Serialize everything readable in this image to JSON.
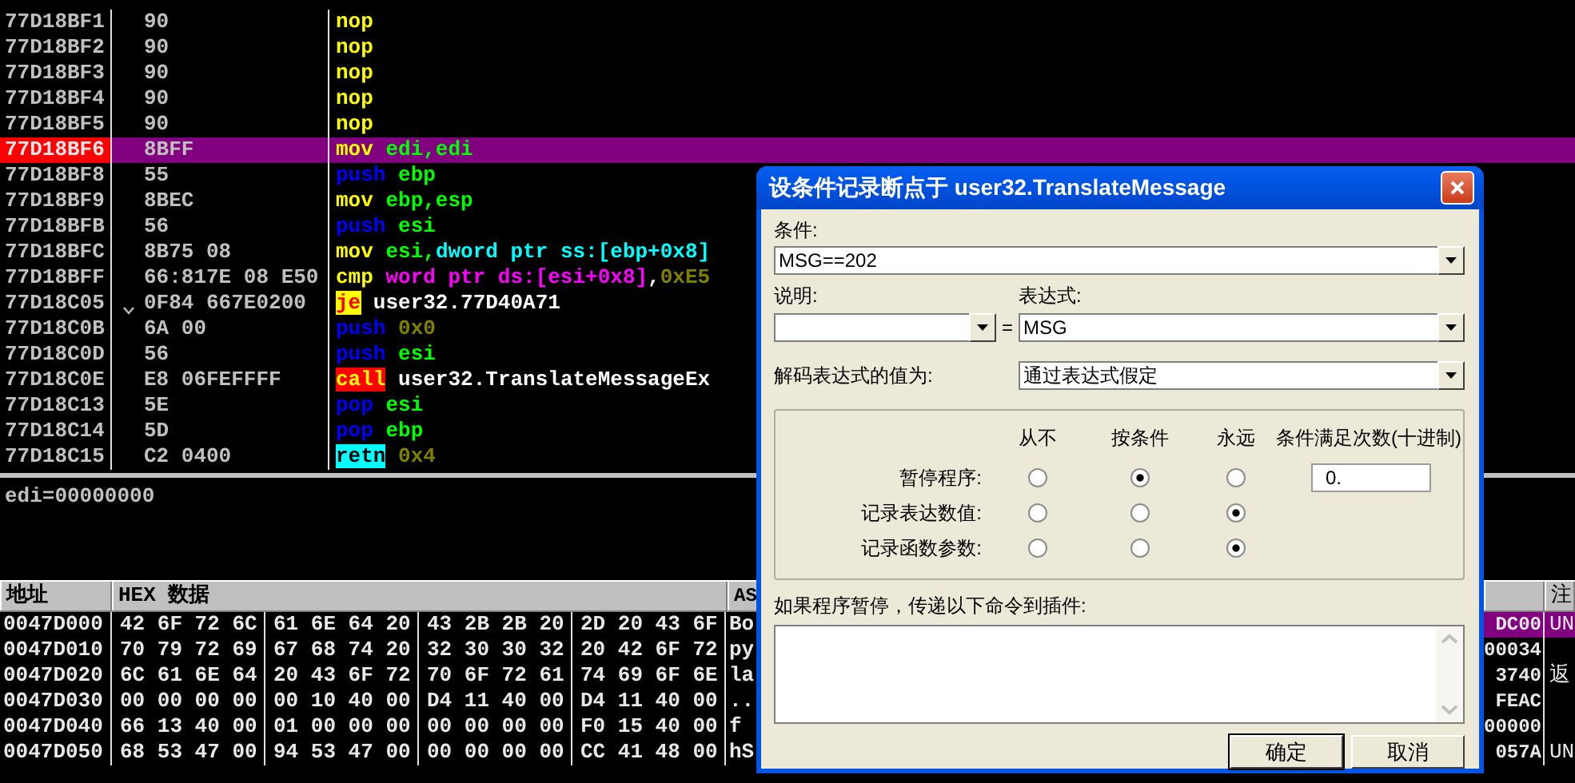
{
  "disassembly": {
    "rows": [
      {
        "address": "77D18BF1",
        "hex": "90",
        "jump_mark": false,
        "selected": false,
        "tokens": [
          {
            "text": "nop",
            "kind": "mnemonic"
          }
        ]
      },
      {
        "address": "77D18BF2",
        "hex": "90",
        "jump_mark": false,
        "selected": false,
        "tokens": [
          {
            "text": "nop",
            "kind": "mnemonic"
          }
        ]
      },
      {
        "address": "77D18BF3",
        "hex": "90",
        "jump_mark": false,
        "selected": false,
        "tokens": [
          {
            "text": "nop",
            "kind": "mnemonic"
          }
        ]
      },
      {
        "address": "77D18BF4",
        "hex": "90",
        "jump_mark": false,
        "selected": false,
        "tokens": [
          {
            "text": "nop",
            "kind": "mnemonic"
          }
        ]
      },
      {
        "address": "77D18BF5",
        "hex": "90",
        "jump_mark": false,
        "selected": false,
        "tokens": [
          {
            "text": "nop",
            "kind": "mnemonic"
          }
        ]
      },
      {
        "address": "77D18BF6",
        "hex": "8BFF",
        "jump_mark": false,
        "selected": true,
        "tokens": [
          {
            "text": "mov",
            "kind": "mnemonic"
          },
          {
            "text": "edi,edi",
            "kind": "register"
          }
        ]
      },
      {
        "address": "77D18BF8",
        "hex": "55",
        "jump_mark": false,
        "selected": false,
        "tokens": [
          {
            "text": "push",
            "kind": "stack"
          },
          {
            "text": "ebp",
            "kind": "register"
          }
        ]
      },
      {
        "address": "77D18BF9",
        "hex": "8BEC",
        "jump_mark": false,
        "selected": false,
        "tokens": [
          {
            "text": "mov",
            "kind": "mnemonic"
          },
          {
            "text": "ebp,esp",
            "kind": "register"
          }
        ]
      },
      {
        "address": "77D18BFB",
        "hex": "56",
        "jump_mark": false,
        "selected": false,
        "tokens": [
          {
            "text": "push",
            "kind": "stack"
          },
          {
            "text": "esi",
            "kind": "register"
          }
        ]
      },
      {
        "address": "77D18BFC",
        "hex": "8B75 08",
        "jump_mark": false,
        "selected": false,
        "tokens": [
          {
            "text": "mov",
            "kind": "mnemonic"
          },
          {
            "text": "esi,",
            "kind": "register"
          },
          {
            "text": "dword ptr ss:[ebp+0x8]",
            "kind": "memory_ss"
          }
        ]
      },
      {
        "address": "77D18BFF",
        "hex": "66:817E 08 E50",
        "jump_mark": false,
        "selected": false,
        "tokens": [
          {
            "text": "cmp",
            "kind": "mnemonic"
          },
          {
            "text": "word ptr ds:[esi+0x8]",
            "kind": "memory_ds"
          },
          {
            "text": ",",
            "kind": "separator"
          },
          {
            "text": "0xE5",
            "kind": "constant"
          }
        ]
      },
      {
        "address": "77D18C05",
        "hex": "0F84 667E0200",
        "jump_mark": true,
        "selected": false,
        "tokens": [
          {
            "text": "je",
            "kind": "jump"
          },
          {
            "text": "user32.77D40A71",
            "kind": "symbol"
          }
        ]
      },
      {
        "address": "77D18C0B",
        "hex": "6A 00",
        "jump_mark": false,
        "selected": false,
        "tokens": [
          {
            "text": "push",
            "kind": "stack"
          },
          {
            "text": "0x0",
            "kind": "constant"
          }
        ]
      },
      {
        "address": "77D18C0D",
        "hex": "56",
        "jump_mark": false,
        "selected": false,
        "tokens": [
          {
            "text": "push",
            "kind": "stack"
          },
          {
            "text": "esi",
            "kind": "register"
          }
        ]
      },
      {
        "address": "77D18C0E",
        "hex": "E8 06FEFFFF",
        "jump_mark": false,
        "selected": false,
        "tokens": [
          {
            "text": "call",
            "kind": "call"
          },
          {
            "text": "user32.TranslateMessageEx",
            "kind": "symbol"
          }
        ]
      },
      {
        "address": "77D18C13",
        "hex": "5E",
        "jump_mark": false,
        "selected": false,
        "tokens": [
          {
            "text": "pop",
            "kind": "stack"
          },
          {
            "text": "esi",
            "kind": "register"
          }
        ]
      },
      {
        "address": "77D18C14",
        "hex": "5D",
        "jump_mark": false,
        "selected": false,
        "tokens": [
          {
            "text": "pop",
            "kind": "stack"
          },
          {
            "text": "ebp",
            "kind": "register"
          }
        ]
      },
      {
        "address": "77D18C15",
        "hex": "C2 0400",
        "jump_mark": false,
        "selected": false,
        "tokens": [
          {
            "text": "retn",
            "kind": "ret"
          },
          {
            "text": "0x4",
            "kind": "constant"
          }
        ]
      }
    ]
  },
  "info": {
    "text": "edi=00000000"
  },
  "dump": {
    "columns": [
      "地址",
      "HEX 数据",
      "AS"
    ],
    "rows": [
      {
        "address": "0047D000",
        "bytes": [
          "42 6F 72 6C",
          "61 6E 64 20",
          "43 2B 2B 20",
          "2D 20 43 6F"
        ],
        "ascii": "Bo"
      },
      {
        "address": "0047D010",
        "bytes": [
          "70 79 72 69",
          "67 68 74 20",
          "32 30 30 32",
          "20 42 6F 72"
        ],
        "ascii": "py"
      },
      {
        "address": "0047D020",
        "bytes": [
          "6C 61 6E 64",
          "20 43 6F 72",
          "70 6F 72 61",
          "74 69 6F 6E"
        ],
        "ascii": "la"
      },
      {
        "address": "0047D030",
        "bytes": [
          "00 00 00 00",
          "00 10 40 00",
          "D4 11 40 00",
          "D4 11 40 00"
        ],
        "ascii": ".."
      },
      {
        "address": "0047D040",
        "bytes": [
          "66 13 40 00",
          "01 00 00 00",
          "00 00 00 00",
          "F0 15 40 00"
        ],
        "ascii": "f"
      },
      {
        "address": "0047D050",
        "bytes": [
          "68 53 47 00",
          "94 53 47 00",
          "00 00 00 00",
          "CC 41 48 00"
        ],
        "ascii": "hS"
      }
    ]
  },
  "stack": {
    "comment_header": "注",
    "rows": [
      {
        "value": "DC00",
        "comment": "UN",
        "selected": true
      },
      {
        "value": "00034",
        "comment": "",
        "selected": false
      },
      {
        "value": "3740",
        "comment": "返",
        "selected": false
      },
      {
        "value": "FEAC",
        "comment": "",
        "selected": false
      },
      {
        "value": "00000",
        "comment": "",
        "selected": false
      },
      {
        "value": "057A",
        "comment": "UN",
        "selected": false
      }
    ]
  },
  "dialog": {
    "title": "设条件记录断点于 user32.TranslateMessage",
    "condition": {
      "label": "条件:",
      "value": "MSG==202"
    },
    "explanation": {
      "label": "说明:"
    },
    "equals": "=",
    "expression": {
      "label": "表达式:",
      "value": "MSG"
    },
    "decode": {
      "label": "解码表达式的值为:",
      "value": "通过表达式假定"
    },
    "options": {
      "columns": [
        "从不",
        "按条件",
        "永远",
        "条件满足次数(十进制)"
      ],
      "rows": [
        {
          "label": "暂停程序:",
          "choices": [
            {
              "selected": false
            },
            {
              "selected": true
            },
            {
              "selected": false
            }
          ],
          "count": "0."
        },
        {
          "label": "记录表达数值:",
          "choices": [
            {
              "selected": false
            },
            {
              "selected": false
            },
            {
              "selected": true
            }
          ]
        },
        {
          "label": "记录函数参数:",
          "choices": [
            {
              "selected": false
            },
            {
              "selected": false
            },
            {
              "selected": true
            }
          ]
        }
      ]
    },
    "plugin_label": "如果程序暂停，传递以下命令到插件:",
    "buttons": [
      {
        "label": "确定",
        "default": true
      },
      {
        "label": "取消",
        "default": false
      }
    ]
  }
}
